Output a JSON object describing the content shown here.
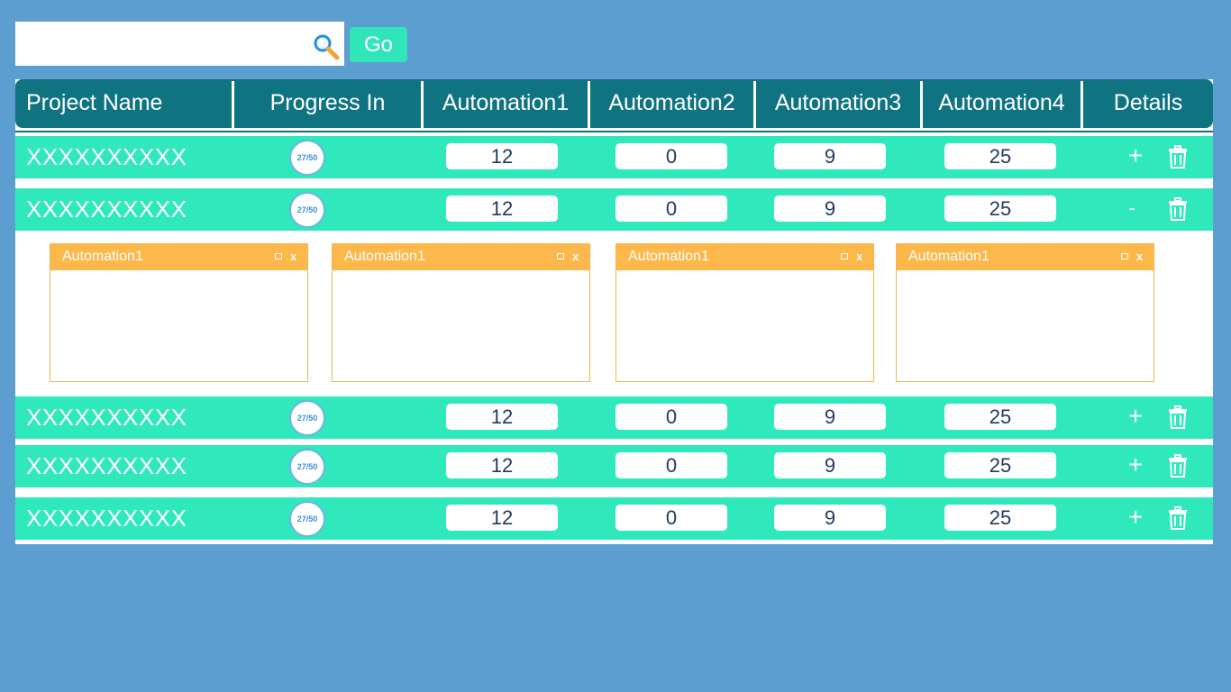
{
  "search": {
    "value": "",
    "placeholder": "",
    "go_label": "Go"
  },
  "columns": [
    "Project  Name",
    "Progress  In",
    "Automation1",
    "Automation2",
    "Automation3",
    "Automation4",
    "Details"
  ],
  "rows": [
    {
      "name": "XXXXXXXXXX",
      "progress": "27/50",
      "a1": "12",
      "a2": "0",
      "a3": "9",
      "a4": "25",
      "toggle": "+"
    },
    {
      "name": "XXXXXXXXXX",
      "progress": "27/50",
      "a1": "12",
      "a2": "0",
      "a3": "9",
      "a4": "25",
      "toggle": "-"
    },
    {
      "name": "XXXXXXXXXX",
      "progress": "27/50",
      "a1": "12",
      "a2": "0",
      "a3": "9",
      "a4": "25",
      "toggle": "+"
    },
    {
      "name": "XXXXXXXXXX",
      "progress": "27/50",
      "a1": "12",
      "a2": "0",
      "a3": "9",
      "a4": "25",
      "toggle": "+"
    },
    {
      "name": "XXXXXXXXXX",
      "progress": "27/50",
      "a1": "12",
      "a2": "0",
      "a3": "9",
      "a4": "25",
      "toggle": "+"
    }
  ],
  "expanded_panels": [
    {
      "title": "Automation1",
      "close": "x"
    },
    {
      "title": "Automation1",
      "close": "x"
    },
    {
      "title": "Automation1",
      "close": "x"
    },
    {
      "title": "Automation1",
      "close": "x"
    }
  ],
  "colors": {
    "background": "#5b9ecf",
    "header": "#0f7381",
    "row": "#2fe8bc",
    "panel_header": "#fdb84c",
    "go_button": "#2fe6bb"
  },
  "icons": [
    "search-icon",
    "trash-icon",
    "maximize-icon",
    "close-icon"
  ]
}
